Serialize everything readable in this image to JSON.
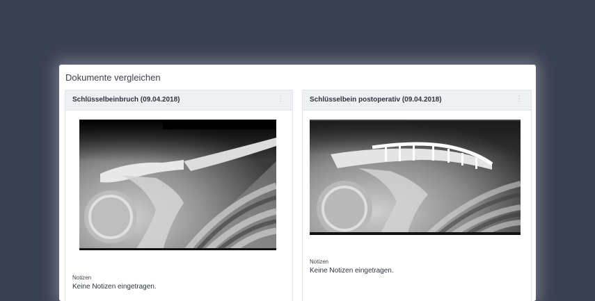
{
  "modal": {
    "title": "Dokumente vergleichen"
  },
  "documents": [
    {
      "title": "Schlüsselbeinbruch (09.04.2018)",
      "notes_label": "Notizen",
      "notes_text": "Keine Notizen eingetragen.",
      "image_name": "clavicle-fracture-xray"
    },
    {
      "title": "Schlüsselbein postoperativ (09.04.2018)",
      "notes_label": "Notizen",
      "notes_text": "Keine Notizen eingetragen.",
      "image_name": "clavicle-postoperative-xray"
    }
  ],
  "icons": {
    "menu": "kebab-menu-icon"
  }
}
